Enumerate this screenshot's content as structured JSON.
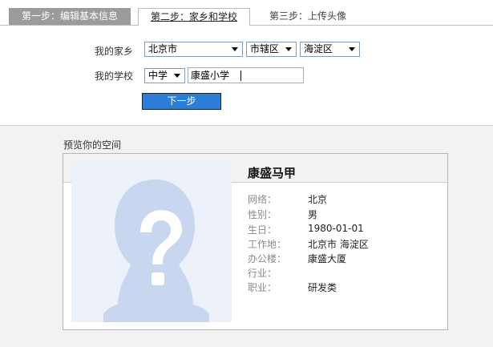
{
  "tabs": [
    {
      "label": "第一步：编辑基本信息"
    },
    {
      "label": "第二步：家乡和学校"
    },
    {
      "label": "第三步：上传头像"
    }
  ],
  "form": {
    "hometown_label": "我的家乡",
    "hometown_province": "北京市",
    "hometown_city": "市辖区",
    "hometown_district": "海淀区",
    "school_label": "我的学校",
    "school_type": "中学",
    "school_name": "康盛小学",
    "next_button": "下一步"
  },
  "preview": {
    "title": "预览你的空间",
    "name": "康盛马甲",
    "fields": [
      {
        "key": "网络：",
        "value": "北京"
      },
      {
        "key": "性别：",
        "value": "男"
      },
      {
        "key": "生日：",
        "value": "1980-01-01"
      },
      {
        "key": "工作地：",
        "value": "北京市 海淀区"
      },
      {
        "key": "办公楼：",
        "value": "康盛大厦"
      },
      {
        "key": "行业：",
        "value": ""
      },
      {
        "key": "职业：",
        "value": "研发类"
      }
    ]
  },
  "icons": {
    "avatar_placeholder": "question-mark-silhouette-icon",
    "dropdown": "triangle-down-icon"
  },
  "colors": {
    "button_bg": "#2a7ed8",
    "inactive_tab_bg": "#9b9b9b",
    "avatar_fill": "#c9d6ef"
  }
}
